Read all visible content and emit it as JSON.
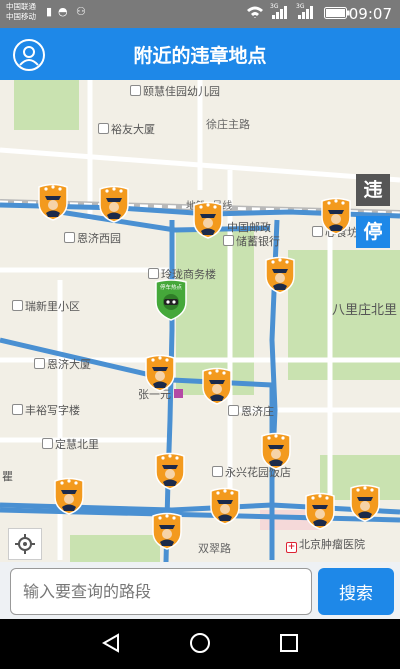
{
  "status_bar": {
    "carrier_1": "中国联通",
    "carrier_2": "中国移动",
    "net_1": "3G",
    "net_2": "3G",
    "time": "09:07"
  },
  "header": {
    "title": "附近的违章地点",
    "avatar_icon": "user-avatar-icon"
  },
  "map": {
    "pois": [
      {
        "label": "颐慧佳园幼儿园",
        "kind": "poi"
      },
      {
        "label": "裕友大厦",
        "kind": "poi"
      },
      {
        "label": "徐庄主路",
        "kind": "road"
      },
      {
        "label": "中国邮政",
        "kind": "text"
      },
      {
        "label": "储蓄银行",
        "kind": "text"
      },
      {
        "label": "心食坊",
        "kind": "text"
      },
      {
        "label": "地铁5号线",
        "kind": "road"
      },
      {
        "label": "恩济西园",
        "kind": "poi"
      },
      {
        "label": "玲珑商务楼",
        "kind": "poi"
      },
      {
        "label": "瑞新里小区",
        "kind": "poi"
      },
      {
        "label": "八里庄北里",
        "kind": "text"
      },
      {
        "label": "恩济大厦",
        "kind": "poi"
      },
      {
        "label": "张一元",
        "kind": "text"
      },
      {
        "label": "丰裕写字楼",
        "kind": "poi"
      },
      {
        "label": "恩济庄",
        "kind": "poi"
      },
      {
        "label": "定慧北里",
        "kind": "poi"
      },
      {
        "label": "永兴花园饭店",
        "kind": "poi"
      },
      {
        "label": "双翠路",
        "kind": "road"
      },
      {
        "label": "北京肿瘤医院",
        "kind": "hospital"
      },
      {
        "label": "瞿",
        "kind": "text"
      }
    ],
    "green_marker_label": "停车热点",
    "violation_marker_icon": "police-badge-icon"
  },
  "side_buttons": {
    "violation": "违",
    "parking": "停"
  },
  "locate_icon": "locate-icon",
  "search": {
    "placeholder": "输入要查询的路段",
    "button_label": "搜索"
  },
  "nav": {
    "back_icon": "back-triangle-icon",
    "home_icon": "home-circle-icon",
    "recents_icon": "recents-square-icon"
  },
  "colors": {
    "header_blue": "#1e88e8",
    "marker_orange": "#f39a1e",
    "road_blue": "#4a90d2",
    "park_green": "#c9e2b0"
  }
}
